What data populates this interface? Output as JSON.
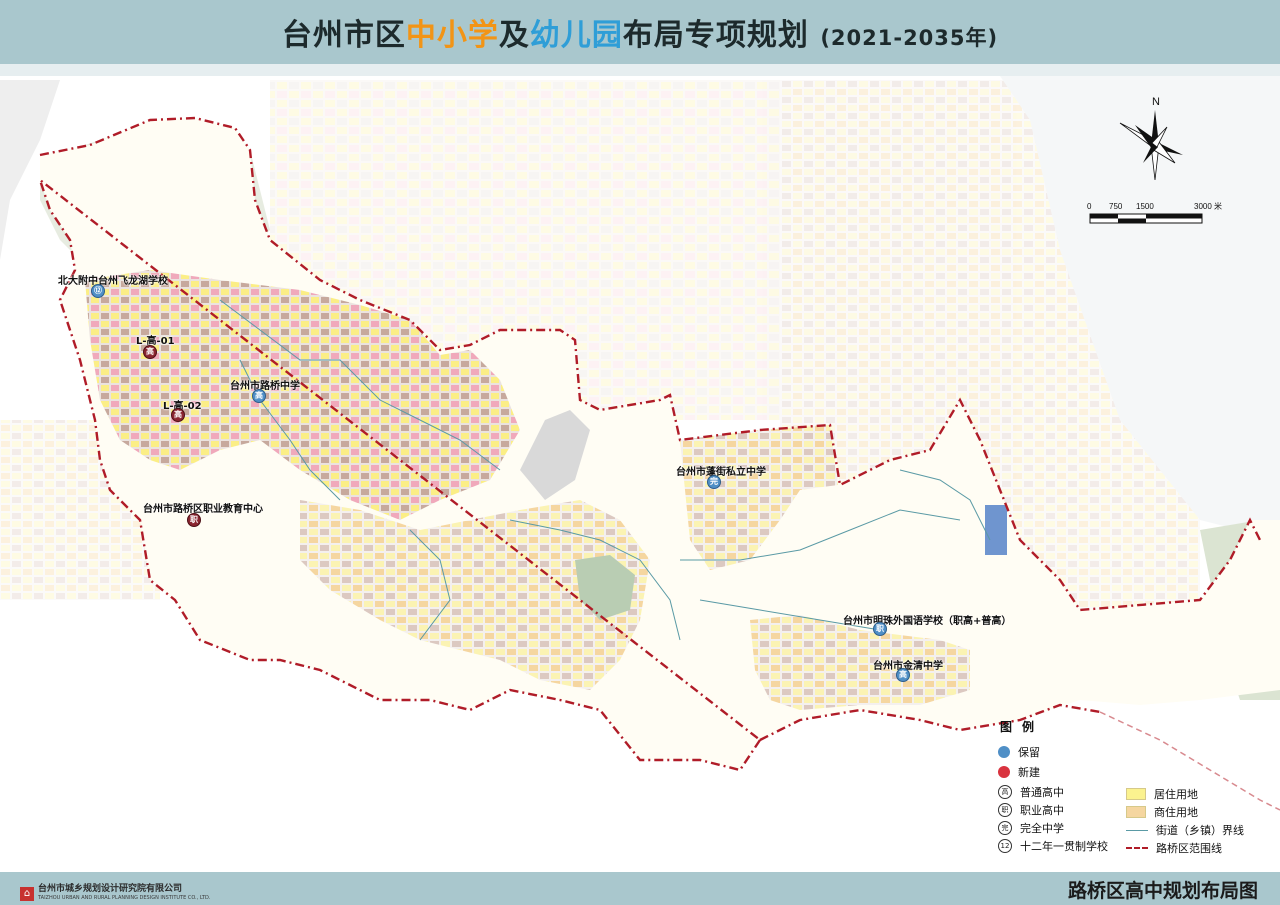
{
  "title": {
    "part1": "台州市区",
    "part2": "中小学",
    "part3": "及",
    "part4": "幼儿园",
    "part5": "布局",
    "part6": "专项规划",
    "year": "(2021-2035年)"
  },
  "colors": {
    "header": "#a9c7cd",
    "title_orange": "#f29415",
    "title_blue": "#2f9ed7",
    "boundary": "#b01c28",
    "residential": "#fbf28f",
    "commercial_residential": "#f5d6a0",
    "keep_dot": "#4f8fc6",
    "new_dot": "#d9333f"
  },
  "compass": {
    "north": "N"
  },
  "scale": {
    "labels": [
      "0",
      "750",
      "1500",
      "3000 米"
    ]
  },
  "schools": [
    {
      "name": "北大附中台州飞龙湖学校",
      "symbol": "⑫",
      "status": "keep"
    },
    {
      "name": "L-高-01",
      "symbol": "高",
      "status": "new"
    },
    {
      "name": "台州市路桥中学",
      "symbol": "高",
      "status": "keep"
    },
    {
      "name": "L-高-02",
      "symbol": "高",
      "status": "new"
    },
    {
      "name": "台州市路桥区职业教育中心",
      "symbol": "职",
      "status": "new"
    },
    {
      "name": "台州市蓬街私立中学",
      "symbol": "完",
      "status": "keep"
    },
    {
      "name": "台州市明珠外国语学校（职高+普高）",
      "symbol": "职",
      "status": "keep"
    },
    {
      "name": "台州市金清中学",
      "symbol": "高",
      "status": "keep"
    }
  ],
  "legend": {
    "title": "图例",
    "keep": "保留",
    "new": "新建",
    "high": "普通高中",
    "high_sym": "高",
    "vocational": "职业高中",
    "vocational_sym": "职",
    "complete": "完全中学",
    "complete_sym": "完",
    "twelve": "十二年一贯制学校",
    "twelve_sym": "12",
    "residential": "居住用地",
    "commercial": "商住用地",
    "street_line": "街道（乡镇）界线",
    "district_line": "路桥区范围线"
  },
  "footer": {
    "title": "路桥区高中规划布局图",
    "institute": "台州市城乡规划设计研究院有限公司",
    "institute_en": "TAIZHOU URBAN AND RURAL PLANNING DESIGN INSTITUTE CO., LTD."
  }
}
